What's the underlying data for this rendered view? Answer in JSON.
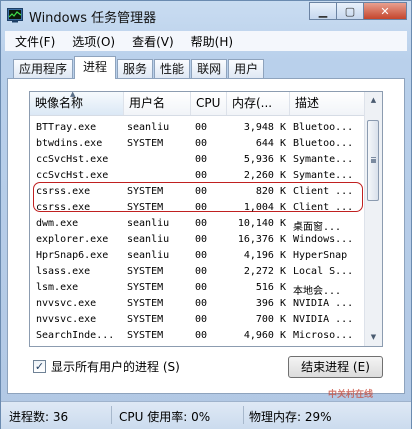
{
  "window": {
    "title": "Windows 任务管理器"
  },
  "menu": [
    "文件(F)",
    "选项(O)",
    "查看(V)",
    "帮助(H)"
  ],
  "tabs": [
    "应用程序",
    "进程",
    "服务",
    "性能",
    "联网",
    "用户"
  ],
  "columns": {
    "name": "映像名称",
    "user": "用户名",
    "cpu": "CPU",
    "memory": "内存(...",
    "desc": "描述"
  },
  "processes": [
    {
      "name": "BTTray.exe",
      "user": "seanliu",
      "cpu": "00",
      "mem": "3,948 K",
      "desc": "Bluetoo..."
    },
    {
      "name": "btwdins.exe",
      "user": "SYSTEM",
      "cpu": "00",
      "mem": "644 K",
      "desc": "Bluetoo..."
    },
    {
      "name": "ccSvcHst.exe",
      "user": "",
      "cpu": "00",
      "mem": "5,936 K",
      "desc": "Symante..."
    },
    {
      "name": "ccSvcHst.exe",
      "user": "",
      "cpu": "00",
      "mem": "2,260 K",
      "desc": "Symante..."
    },
    {
      "name": "csrss.exe",
      "user": "SYSTEM",
      "cpu": "00",
      "mem": "820 K",
      "desc": "Client ..."
    },
    {
      "name": "csrss.exe",
      "user": "SYSTEM",
      "cpu": "00",
      "mem": "1,004 K",
      "desc": "Client ..."
    },
    {
      "name": "dwm.exe",
      "user": "seanliu",
      "cpu": "00",
      "mem": "10,140 K",
      "desc": "桌面窗..."
    },
    {
      "name": "explorer.exe",
      "user": "seanliu",
      "cpu": "00",
      "mem": "16,376 K",
      "desc": "Windows..."
    },
    {
      "name": "HprSnap6.exe",
      "user": "seanliu",
      "cpu": "00",
      "mem": "4,196 K",
      "desc": "HyperSnap"
    },
    {
      "name": "lsass.exe",
      "user": "SYSTEM",
      "cpu": "00",
      "mem": "2,272 K",
      "desc": "Local S..."
    },
    {
      "name": "lsm.exe",
      "user": "SYSTEM",
      "cpu": "00",
      "mem": "516 K",
      "desc": "本地会..."
    },
    {
      "name": "nvvsvc.exe",
      "user": "SYSTEM",
      "cpu": "00",
      "mem": "396 K",
      "desc": "NVIDIA ..."
    },
    {
      "name": "nvvsvc.exe",
      "user": "SYSTEM",
      "cpu": "00",
      "mem": "700 K",
      "desc": "NVIDIA ..."
    },
    {
      "name": "SearchInde...",
      "user": "SYSTEM",
      "cpu": "00",
      "mem": "4,960 K",
      "desc": "Microso..."
    }
  ],
  "show_all_label": "显示所有用户的进程 (S)",
  "show_all_checked": true,
  "end_process_label": "结束进程 (E)",
  "status": {
    "processes": "进程数: 36",
    "cpu": "CPU 使用率: 0%",
    "memory": "物理内存: 29%"
  },
  "watermark": "中关村在线",
  "icons": {
    "app": "task-manager-icon",
    "minimize": "minimize-icon",
    "maximize": "maximize-icon",
    "close": "close-icon",
    "checkbox": "checkmark-icon"
  },
  "colors": {
    "highlight": "#c02020",
    "window_frame": "#b9d0eb",
    "close_button": "#c4452c"
  }
}
